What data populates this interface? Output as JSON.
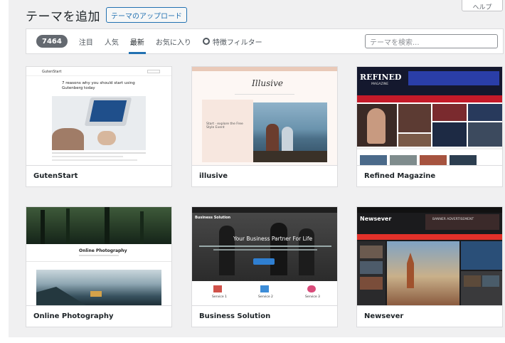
{
  "help_tab": {
    "label": "ヘルプ"
  },
  "header": {
    "title": "テーマを追加",
    "upload_label": "テーマのアップロード"
  },
  "filters": {
    "count": "7464",
    "links": [
      "注目",
      "人気",
      "最新",
      "お気に入り"
    ],
    "current": "最新",
    "feature_filter": "特徴フィルター",
    "search_placeholder": "テーマを検索..."
  },
  "themes": [
    {
      "name": "GutenStart",
      "preview": {
        "brand": "GutenStart",
        "headline": "7 reasons why you should start using Gutenberg today"
      }
    },
    {
      "name": "illusive",
      "preview": {
        "brand": "Illusive",
        "caption": "Start · explore the Free Style Event"
      }
    },
    {
      "name": "Refined Magazine",
      "preview": {
        "brand": "REFINED",
        "sub": "MAGAZINE"
      }
    },
    {
      "name": "Online Photography",
      "preview": {
        "brand": "Online Photography"
      }
    },
    {
      "name": "Business Solution",
      "preview": {
        "brand": "Business Solution",
        "headline": "Your Business Partner For Life",
        "services": [
          "Service 1",
          "Service 2",
          "Service 3"
        ]
      }
    },
    {
      "name": "Newsever",
      "preview": {
        "brand": "Newsever",
        "banner": "BANNER ADVERTISEMENT"
      }
    }
  ],
  "colors": {
    "accent": "#2271b1",
    "badge": "#646970",
    "background": "#f0f0f1"
  }
}
